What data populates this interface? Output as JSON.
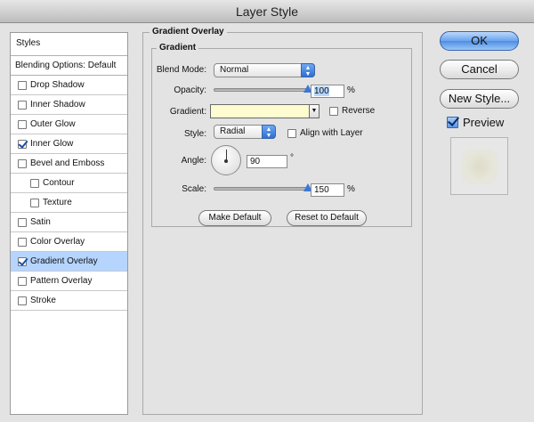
{
  "window": {
    "title": "Layer Style"
  },
  "styles_panel": {
    "header": "Styles",
    "blending_options": "Blending Options: Default",
    "items": [
      {
        "label": "Drop Shadow",
        "checked": false,
        "indent": false,
        "selected": false
      },
      {
        "label": "Inner Shadow",
        "checked": false,
        "indent": false,
        "selected": false
      },
      {
        "label": "Outer Glow",
        "checked": false,
        "indent": false,
        "selected": false
      },
      {
        "label": "Inner Glow",
        "checked": true,
        "indent": false,
        "selected": false
      },
      {
        "label": "Bevel and Emboss",
        "checked": false,
        "indent": false,
        "selected": false
      },
      {
        "label": "Contour",
        "checked": false,
        "indent": true,
        "selected": false
      },
      {
        "label": "Texture",
        "checked": false,
        "indent": true,
        "selected": false
      },
      {
        "label": "Satin",
        "checked": false,
        "indent": false,
        "selected": false
      },
      {
        "label": "Color Overlay",
        "checked": false,
        "indent": false,
        "selected": false
      },
      {
        "label": "Gradient Overlay",
        "checked": true,
        "indent": false,
        "selected": true
      },
      {
        "label": "Pattern Overlay",
        "checked": false,
        "indent": false,
        "selected": false
      },
      {
        "label": "Stroke",
        "checked": false,
        "indent": false,
        "selected": false
      }
    ]
  },
  "gradient_overlay": {
    "group_title": "Gradient Overlay",
    "subgroup_title": "Gradient",
    "blend_mode": {
      "label": "Blend Mode:",
      "value": "Normal"
    },
    "opacity": {
      "label": "Opacity:",
      "value": "100",
      "unit": "%",
      "level": 1.0
    },
    "gradient": {
      "label": "Gradient:",
      "color": "#fdfbd0"
    },
    "reverse": {
      "label": "Reverse",
      "checked": false
    },
    "style": {
      "label": "Style:",
      "value": "Radial"
    },
    "align_with_layer": {
      "label": "Align with Layer",
      "checked": false
    },
    "angle": {
      "label": "Angle:",
      "value": "90",
      "unit": "°"
    },
    "scale": {
      "label": "Scale:",
      "value": "150",
      "unit": "%",
      "level": 1.0
    },
    "make_default": "Make Default",
    "reset_to_default": "Reset to Default"
  },
  "buttons": {
    "ok": "OK",
    "cancel": "Cancel",
    "new_style": "New Style..."
  },
  "preview": {
    "label": "Preview",
    "checked": true
  },
  "colors": {
    "selection": "#b5d5ff",
    "accent": "#4d8ee4",
    "gradient_swatch": "#fdfbd0"
  }
}
